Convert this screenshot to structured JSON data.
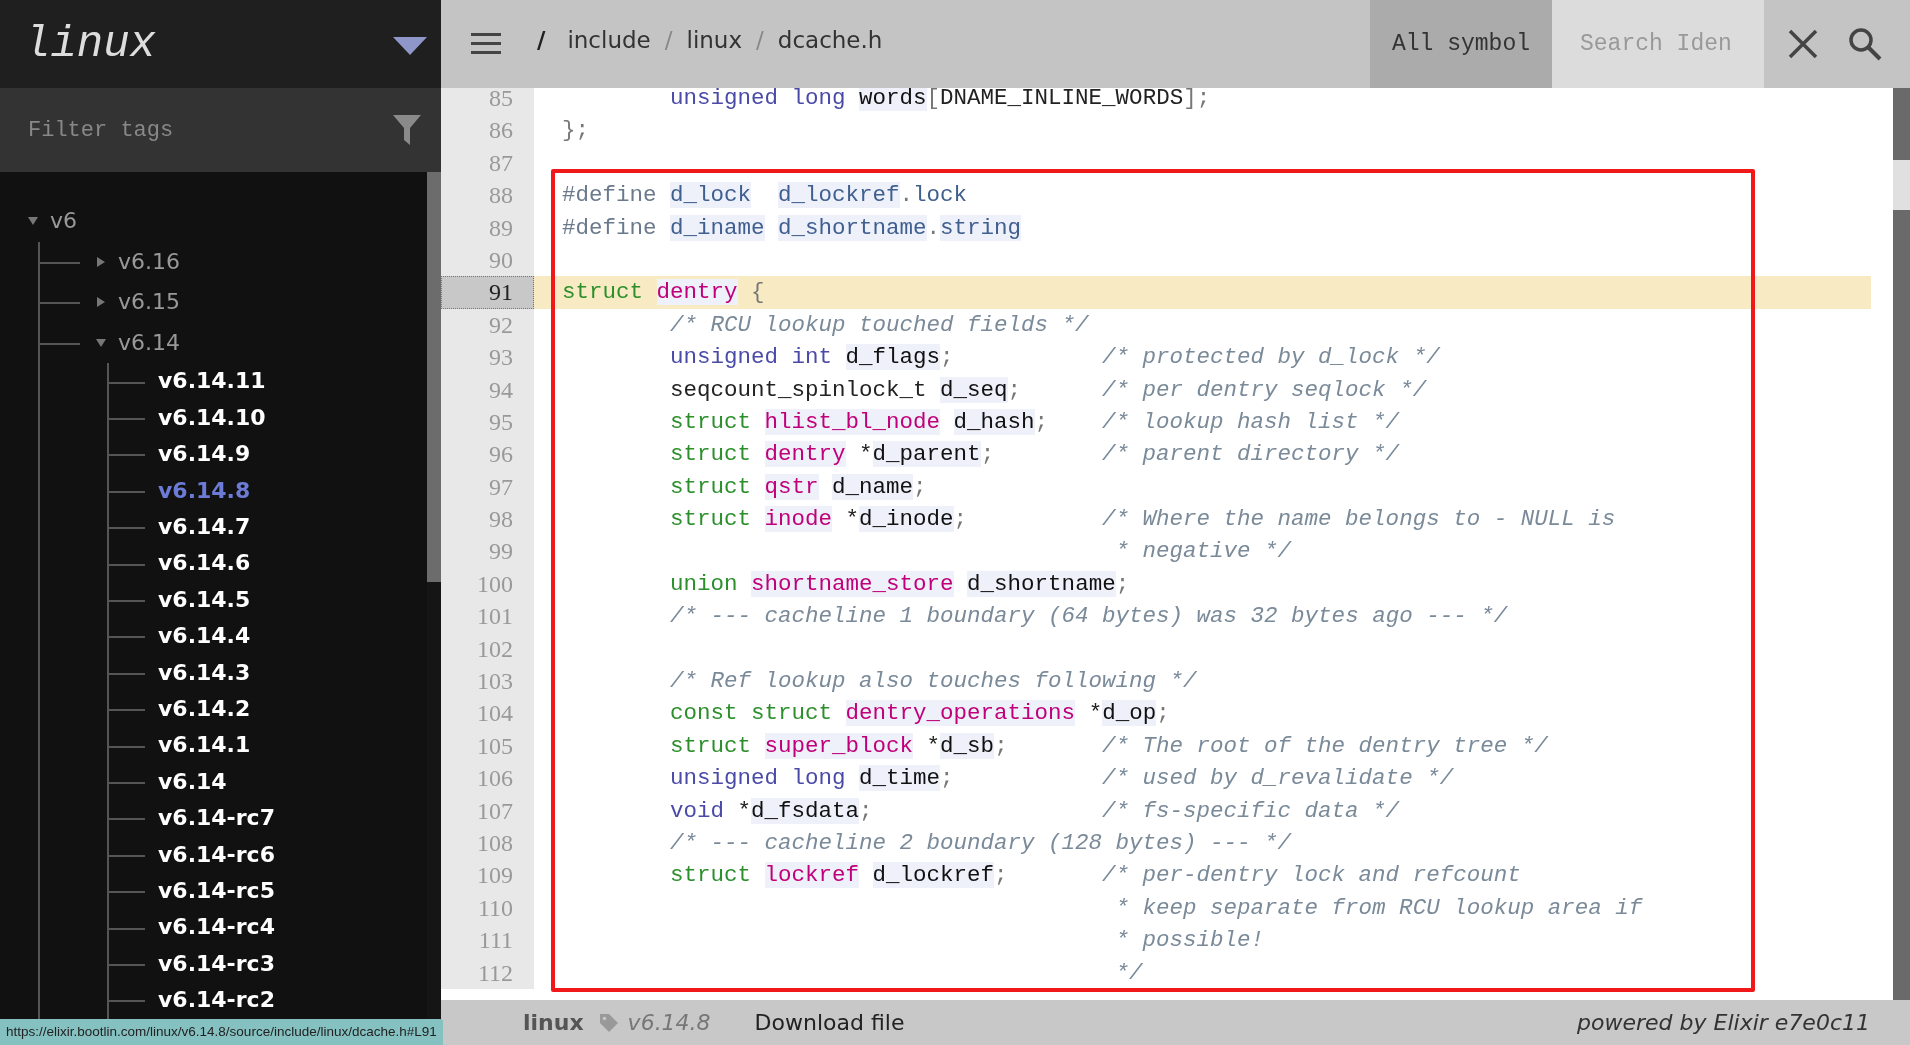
{
  "sidebar": {
    "project": "linux",
    "filter": {
      "placeholder": "Filter tags"
    },
    "tree": [
      {
        "label": "v6",
        "expanded": true,
        "children": [
          {
            "label": "v6.16",
            "expanded": false
          },
          {
            "label": "v6.15",
            "expanded": false
          },
          {
            "label": "v6.14",
            "expanded": true,
            "children": [
              {
                "label": "v6.14.11",
                "selected": false
              },
              {
                "label": "v6.14.10",
                "selected": false
              },
              {
                "label": "v6.14.9",
                "selected": false
              },
              {
                "label": "v6.14.8",
                "selected": true
              },
              {
                "label": "v6.14.7",
                "selected": false
              },
              {
                "label": "v6.14.6",
                "selected": false
              },
              {
                "label": "v6.14.5",
                "selected": false
              },
              {
                "label": "v6.14.4",
                "selected": false
              },
              {
                "label": "v6.14.3",
                "selected": false
              },
              {
                "label": "v6.14.2",
                "selected": false
              },
              {
                "label": "v6.14.1",
                "selected": false
              },
              {
                "label": "v6.14",
                "selected": false
              },
              {
                "label": "v6.14-rc7",
                "selected": false
              },
              {
                "label": "v6.14-rc6",
                "selected": false
              },
              {
                "label": "v6.14-rc5",
                "selected": false
              },
              {
                "label": "v6.14-rc4",
                "selected": false
              },
              {
                "label": "v6.14-rc3",
                "selected": false
              },
              {
                "label": "v6.14-rc2",
                "selected": false
              }
            ]
          }
        ]
      }
    ]
  },
  "topbar": {
    "breadcrumb": [
      {
        "kind": "root",
        "text": "/"
      },
      {
        "kind": "segment",
        "text": "include"
      },
      {
        "kind": "separator",
        "text": "/"
      },
      {
        "kind": "segment",
        "text": "linux"
      },
      {
        "kind": "separator",
        "text": "/"
      },
      {
        "kind": "segment",
        "text": "dcache.h"
      }
    ],
    "search": {
      "scope": "All symbol",
      "placeholder": "Search Iden"
    }
  },
  "code": {
    "lines": [
      {
        "number": "85",
        "highlighted": false,
        "indented": true,
        "tokens": [
          {
            "kind": "type",
            "text": "unsigned long"
          },
          {
            "kind": "member",
            "text": " words"
          },
          {
            "kind": "punct",
            "text": "["
          },
          {
            "kind": "plain",
            "text": "DNAME_INLINE_WORDS"
          },
          {
            "kind": "punct",
            "text": "];"
          }
        ]
      },
      {
        "number": "86",
        "highlighted": false,
        "indented": false,
        "tokens": [
          {
            "kind": "punct",
            "text": "};"
          }
        ]
      },
      {
        "number": "87",
        "highlighted": false
      },
      {
        "number": "88",
        "highlighted": false,
        "indented": false,
        "tokens": [
          {
            "kind": "preproc",
            "text": "#define"
          },
          {
            "kind": "macro",
            "text": " d_lock"
          },
          {
            "kind": "macro",
            "text": "  d_lockref"
          },
          {
            "kind": "punct",
            "text": "."
          },
          {
            "kind": "macro_text",
            "text": "lock"
          }
        ]
      },
      {
        "number": "89",
        "highlighted": false,
        "indented": false,
        "tokens": [
          {
            "kind": "preproc",
            "text": "#define"
          },
          {
            "kind": "macro",
            "text": " d_iname"
          },
          {
            "kind": "macro",
            "text": " d_shortname"
          },
          {
            "kind": "punct",
            "text": "."
          },
          {
            "kind": "macro",
            "text": "string"
          }
        ]
      },
      {
        "number": "90",
        "highlighted": false
      },
      {
        "number": "91",
        "highlighted": true,
        "indented": false,
        "tokens": [
          {
            "kind": "keyword",
            "text": "struct"
          },
          {
            "kind": "identifier",
            "text": " dentry"
          },
          {
            "kind": "punct",
            "text": " {"
          }
        ]
      },
      {
        "number": "92",
        "highlighted": false,
        "indented": true,
        "tokens": [
          {
            "kind": "comment",
            "text": "/* RCU lookup touched fields */"
          }
        ]
      },
      {
        "number": "93",
        "highlighted": false,
        "indented": true,
        "tokens": [
          {
            "kind": "type",
            "text": "unsigned int"
          },
          {
            "kind": "member",
            "text": " d_flags"
          },
          {
            "kind": "punct",
            "text": ";"
          }
        ],
        "comment": {
          "kind": "trailing",
          "text": "/* protected by d_lock */"
        }
      },
      {
        "number": "94",
        "highlighted": false,
        "indented": true,
        "tokens": [
          {
            "kind": "plain",
            "text": "seqcount_spinlock_t"
          },
          {
            "kind": "member",
            "text": " d_seq"
          },
          {
            "kind": "punct",
            "text": ";"
          }
        ],
        "comment": {
          "kind": "trailing",
          "text": "/* per dentry seqlock */"
        }
      },
      {
        "number": "95",
        "highlighted": false,
        "indented": true,
        "tokens": [
          {
            "kind": "keyword",
            "text": "struct"
          },
          {
            "kind": "identifier",
            "text": " hlist_bl_node"
          },
          {
            "kind": "member",
            "text": " d_hash"
          },
          {
            "kind": "punct",
            "text": ";"
          }
        ],
        "comment": {
          "kind": "trailing",
          "text": "/* lookup hash list */"
        }
      },
      {
        "number": "96",
        "highlighted": false,
        "indented": true,
        "tokens": [
          {
            "kind": "keyword",
            "text": "struct"
          },
          {
            "kind": "identifier",
            "text": " dentry"
          },
          {
            "kind": "plain",
            "text": " *"
          },
          {
            "kind": "member",
            "text": "d_parent"
          },
          {
            "kind": "punct",
            "text": ";"
          }
        ],
        "comment": {
          "kind": "trailing",
          "text": "/* parent directory */"
        }
      },
      {
        "number": "97",
        "highlighted": false,
        "indented": true,
        "tokens": [
          {
            "kind": "keyword",
            "text": "struct"
          },
          {
            "kind": "identifier",
            "text": " qstr"
          },
          {
            "kind": "member",
            "text": " d_name"
          },
          {
            "kind": "punct",
            "text": ";"
          }
        ]
      },
      {
        "number": "98",
        "highlighted": false,
        "indented": true,
        "tokens": [
          {
            "kind": "keyword",
            "text": "struct"
          },
          {
            "kind": "identifier",
            "text": " inode"
          },
          {
            "kind": "plain",
            "text": " *"
          },
          {
            "kind": "member",
            "text": "d_inode"
          },
          {
            "kind": "punct",
            "text": ";"
          }
        ],
        "comment": {
          "kind": "trailing",
          "text": "/* Where the name belongs to - NULL is"
        }
      },
      {
        "number": "99",
        "highlighted": false,
        "indented": true,
        "comment": {
          "kind": "continuation",
          "text": "* negative */"
        }
      },
      {
        "number": "100",
        "highlighted": false,
        "indented": true,
        "tokens": [
          {
            "kind": "keyword",
            "text": "union"
          },
          {
            "kind": "identifier",
            "text": " shortname_store"
          },
          {
            "kind": "member",
            "text": " d_shortname"
          },
          {
            "kind": "punct",
            "text": ";"
          }
        ]
      },
      {
        "number": "101",
        "highlighted": false,
        "indented": true,
        "tokens": [
          {
            "kind": "comment",
            "text": "/* --- cacheline 1 boundary (64 bytes) was 32 bytes ago --- */"
          }
        ]
      },
      {
        "number": "102",
        "highlighted": false
      },
      {
        "number": "103",
        "highlighted": false,
        "indented": true,
        "tokens": [
          {
            "kind": "comment",
            "text": "/* Ref lookup also touches following */"
          }
        ]
      },
      {
        "number": "104",
        "highlighted": false,
        "indented": true,
        "tokens": [
          {
            "kind": "keyword",
            "text": "const struct"
          },
          {
            "kind": "identifier",
            "text": " dentry_operations"
          },
          {
            "kind": "plain",
            "text": " *"
          },
          {
            "kind": "member",
            "text": "d_op"
          },
          {
            "kind": "punct",
            "text": ";"
          }
        ]
      },
      {
        "number": "105",
        "highlighted": false,
        "indented": true,
        "tokens": [
          {
            "kind": "keyword",
            "text": "struct"
          },
          {
            "kind": "identifier",
            "text": " super_block"
          },
          {
            "kind": "plain",
            "text": " *"
          },
          {
            "kind": "member",
            "text": "d_sb"
          },
          {
            "kind": "punct",
            "text": ";"
          }
        ],
        "comment": {
          "kind": "trailing",
          "text": "/* The root of the dentry tree */"
        }
      },
      {
        "number": "106",
        "highlighted": false,
        "indented": true,
        "tokens": [
          {
            "kind": "type",
            "text": "unsigned long"
          },
          {
            "kind": "member",
            "text": " d_time"
          },
          {
            "kind": "punct",
            "text": ";"
          }
        ],
        "comment": {
          "kind": "trailing",
          "text": "/* used by d_revalidate */"
        }
      },
      {
        "number": "107",
        "highlighted": false,
        "indented": true,
        "tokens": [
          {
            "kind": "type",
            "text": "void"
          },
          {
            "kind": "plain",
            "text": " *"
          },
          {
            "kind": "member",
            "text": "d_fsdata"
          },
          {
            "kind": "punct",
            "text": ";"
          }
        ],
        "comment": {
          "kind": "trailing",
          "text": "/* fs-specific data */"
        }
      },
      {
        "number": "108",
        "highlighted": false,
        "indented": true,
        "tokens": [
          {
            "kind": "comment",
            "text": "/* --- cacheline 2 boundary (128 bytes) --- */"
          }
        ]
      },
      {
        "number": "109",
        "highlighted": false,
        "indented": true,
        "tokens": [
          {
            "kind": "keyword",
            "text": "struct"
          },
          {
            "kind": "identifier",
            "text": " lockref"
          },
          {
            "kind": "member",
            "text": " d_lockref"
          },
          {
            "kind": "punct",
            "text": ";"
          }
        ],
        "comment": {
          "kind": "trailing",
          "text": "/* per-dentry lock and refcount"
        }
      },
      {
        "number": "110",
        "highlighted": false,
        "indented": true,
        "comment": {
          "kind": "continuation",
          "text": "* keep separate from RCU lookup area if"
        }
      },
      {
        "number": "111",
        "highlighted": false,
        "indented": true,
        "comment": {
          "kind": "continuation",
          "text": "* possible!"
        }
      },
      {
        "number": "112",
        "highlighted": false,
        "indented": true,
        "comment": {
          "kind": "continuation",
          "text": "*/"
        }
      }
    ]
  },
  "status_bar": {
    "project": "linux",
    "version": "v6.14.8",
    "download": "Download file",
    "powered_by": "powered by Elixir e7e0c11"
  },
  "link_preview": "https://elixir.bootlin.com/linux/v6.14.8/source/include/linux/dcache.h#L91"
}
